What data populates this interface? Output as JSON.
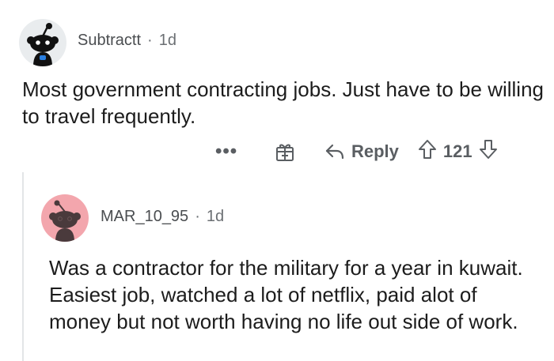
{
  "comment": {
    "author": "Subtractt",
    "separator": "·",
    "time": "1d",
    "text": "Most government contracting jobs. Just have to be willing to travel frequently.",
    "actions": {
      "more_label": "•••",
      "reply_label": "Reply",
      "vote_count": "121"
    }
  },
  "reply": {
    "author": "MAR_10_95",
    "separator": "·",
    "time": "1d",
    "text": "Was a contractor for the military for a year in kuwait. Easiest job, watched a lot of netflix, paid alot of money but not worth having no life out side of work."
  },
  "colors": {
    "avatar_1_bg": "#e9ecee",
    "avatar_2_bg": "#f3a6ad",
    "text": "#1c1c1c",
    "meta": "#4a4d50"
  },
  "icons": {
    "avatar_1": "snoo-avatar-icon",
    "avatar_2": "snoo-avatar-icon",
    "gift": "gift-award-icon",
    "reply": "reply-arrow-icon",
    "upvote": "upvote-arrow-icon",
    "downvote": "downvote-arrow-icon"
  }
}
